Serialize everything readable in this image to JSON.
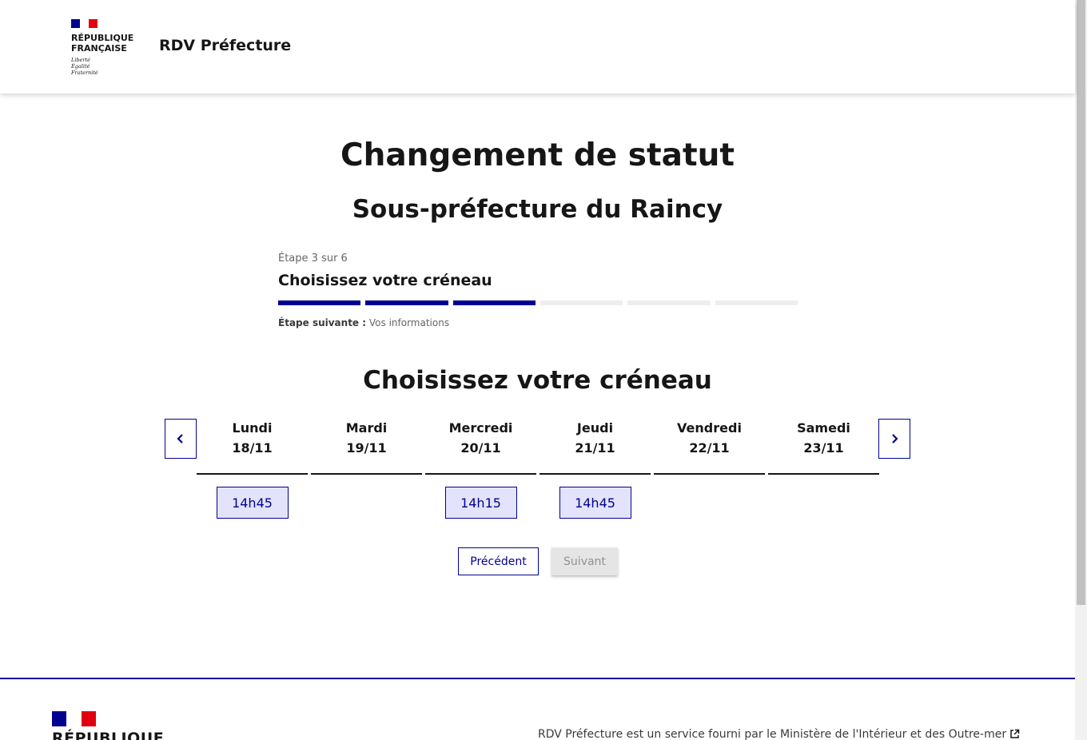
{
  "header": {
    "marianne_title_line1": "RÉPUBLIQUE",
    "marianne_title_line2": "FRANÇAISE",
    "motto_line1": "Liberté",
    "motto_line2": "Égalité",
    "motto_line3": "Fraternité",
    "service_title": "RDV Préfecture"
  },
  "main": {
    "title": "Changement de statut",
    "subtitle": "Sous-préfecture du Raincy",
    "stepper": {
      "state": "Étape 3 sur 6",
      "current_title": "Choisissez votre créneau",
      "total_steps": 6,
      "completed_steps": 3,
      "next_label": "Étape suivante :",
      "next_value": "Vos informations"
    },
    "section_title": "Choisissez votre créneau",
    "days": [
      {
        "name": "Lundi",
        "date": "18/11",
        "slots": [
          "14h45"
        ]
      },
      {
        "name": "Mardi",
        "date": "19/11",
        "slots": []
      },
      {
        "name": "Mercredi",
        "date": "20/11",
        "slots": [
          "14h15"
        ]
      },
      {
        "name": "Jeudi",
        "date": "21/11",
        "slots": [
          "14h45"
        ]
      },
      {
        "name": "Vendredi",
        "date": "22/11",
        "slots": []
      },
      {
        "name": "Samedi",
        "date": "23/11",
        "slots": []
      }
    ],
    "buttons": {
      "previous": "Précédent",
      "next": "Suivant"
    }
  },
  "footer": {
    "marianne_title": "RÉPUBLIQUE",
    "service_text": "RDV Préfecture est un service fourni par le Ministère de l'Intérieur et des Outre-mer"
  },
  "colors": {
    "primary": "#000091",
    "slot_bg": "#e3e3fd",
    "flag_red": "#e1000f",
    "disabled_bg": "#e5e5e5"
  },
  "icons": {
    "prev": "chevron-left-icon",
    "next": "chevron-right-icon",
    "external": "external-link-icon"
  }
}
